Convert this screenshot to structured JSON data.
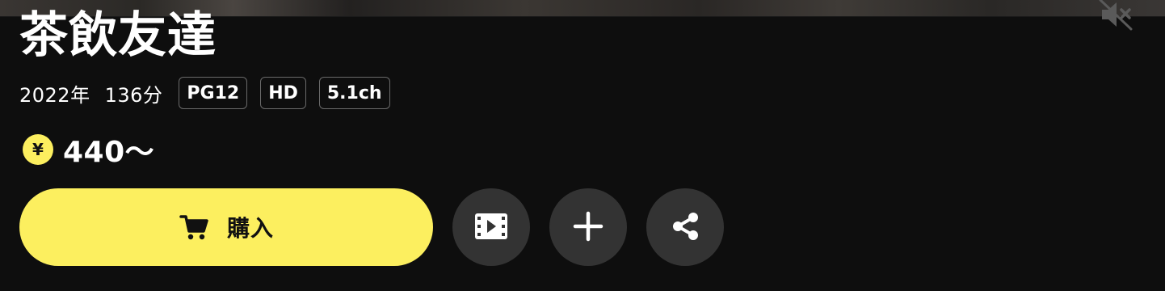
{
  "title": "茶飲友達",
  "meta": {
    "year": "2022年",
    "runtime": "136分",
    "badges": [
      "PG12",
      "HD",
      "5.1ch"
    ]
  },
  "price": {
    "currency_symbol": "¥",
    "amount": "440〜"
  },
  "actions": {
    "buy_label": "購入"
  },
  "icons": {
    "mute": "volume-mute-icon",
    "yen": "yen-coin-icon",
    "cart": "shopping-cart-icon",
    "trailer": "film-play-icon",
    "add": "plus-icon",
    "share": "share-icon"
  },
  "colors": {
    "background": "#0e0e0e",
    "accent_yellow": "#fcef5f",
    "round_button": "#333333",
    "badge_border": "#6a6a6a"
  }
}
